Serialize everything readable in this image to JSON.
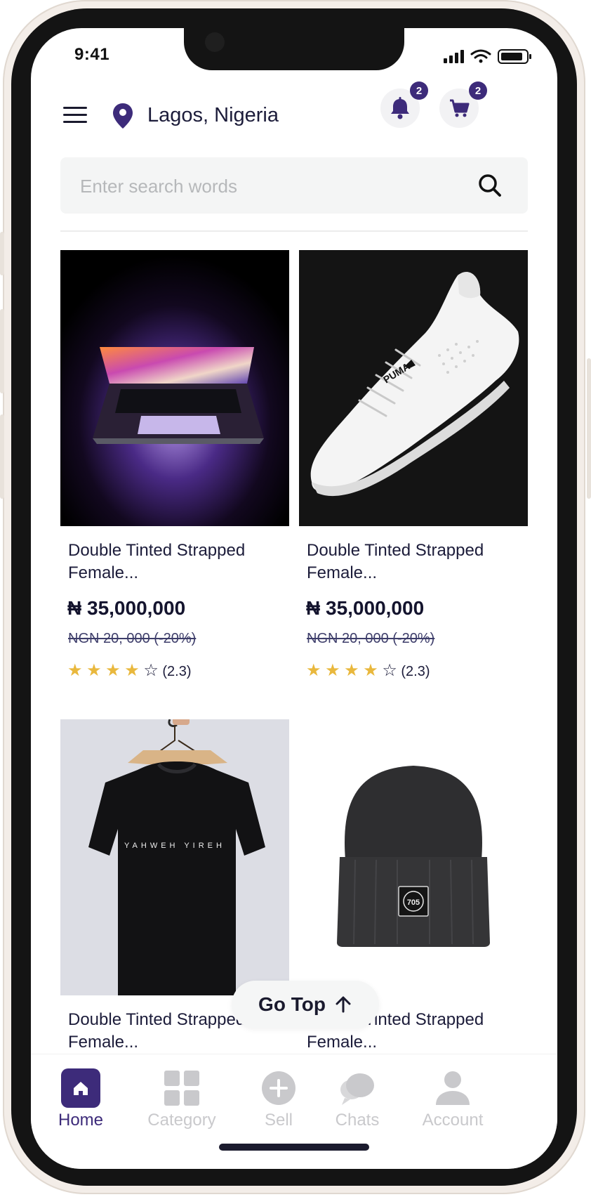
{
  "status_bar": {
    "time": "9:41"
  },
  "header": {
    "location": "Lagos, Nigeria",
    "notifications_count": "2",
    "cart_count": "2"
  },
  "search": {
    "placeholder": "Enter search words",
    "value": ""
  },
  "products": [
    {
      "title": "Double Tinted Strapped Female...",
      "price": "₦ 35,000,000",
      "old_price": "NGN 20, 000 (-20%)",
      "rating": 4,
      "rating_text": "(2.3)",
      "image": "laptop"
    },
    {
      "title": "Double Tinted Strapped Female...",
      "price": "₦ 35,000,000",
      "old_price": "NGN 20, 000 (-20%)",
      "rating": 4,
      "rating_text": "(2.3)",
      "image": "sneaker"
    },
    {
      "title": "Double Tinted Strapped Female...",
      "image": "t-shirt",
      "image_text": "YAHWEH YIREH"
    },
    {
      "title": "Double Tinted Strapped Female...",
      "image": "beanie",
      "image_text": "705"
    }
  ],
  "go_top": {
    "label": "Go Top"
  },
  "bottom_nav": {
    "items": [
      {
        "label": "Home",
        "icon": "home-icon",
        "active": true
      },
      {
        "label": "Category",
        "icon": "grid-icon",
        "active": false
      },
      {
        "label": "Sell",
        "icon": "plus-circle-icon",
        "active": false
      },
      {
        "label": "Chats",
        "icon": "chat-bubbles-icon",
        "active": false
      },
      {
        "label": "Account",
        "icon": "user-icon",
        "active": false
      }
    ]
  },
  "colors": {
    "accent": "#3d2b7a",
    "star": "#e9b83d",
    "inactive_nav": "#c9c9cc",
    "text_dark": "#1c1c3a"
  }
}
